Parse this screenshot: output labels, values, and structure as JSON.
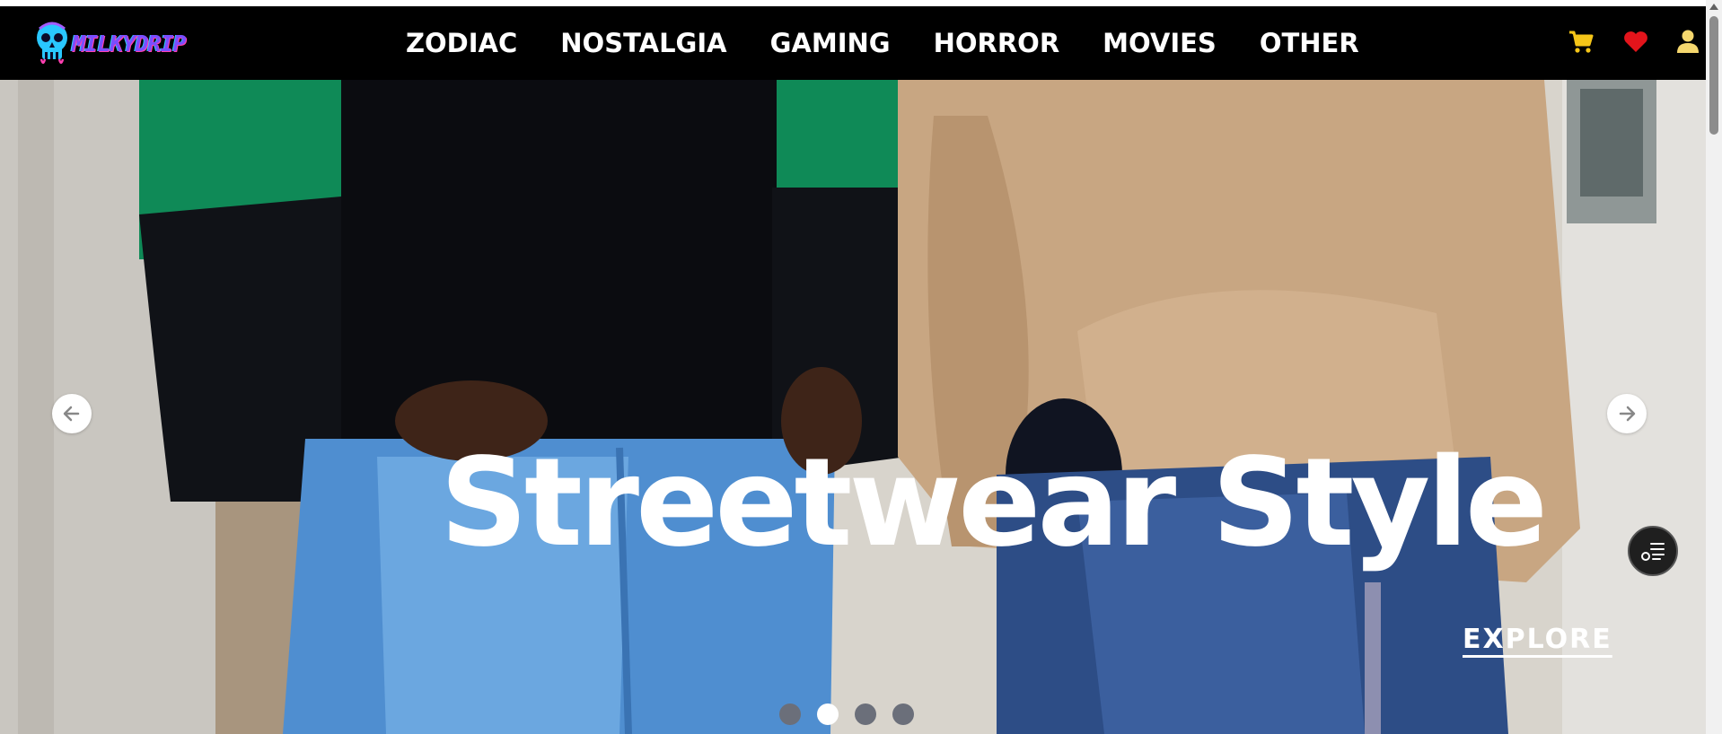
{
  "brand": {
    "name": "MILKYDRIP"
  },
  "nav": {
    "items": [
      {
        "label": "ZODIAC"
      },
      {
        "label": "NOSTALGIA"
      },
      {
        "label": "GAMING"
      },
      {
        "label": "HORROR"
      },
      {
        "label": "MOVIES"
      },
      {
        "label": "OTHER"
      }
    ],
    "icons": [
      "cart-icon",
      "heart-icon",
      "user-icon"
    ]
  },
  "hero": {
    "headline": "Streetwear Style",
    "cta": "EXPLORE",
    "slides": 4,
    "active_slide": 2
  },
  "colors": {
    "nav_bg": "#000000",
    "cart": "#f5c518",
    "heart": "#e3141b",
    "user": "#f5d76e",
    "headline": "#ffffff"
  }
}
